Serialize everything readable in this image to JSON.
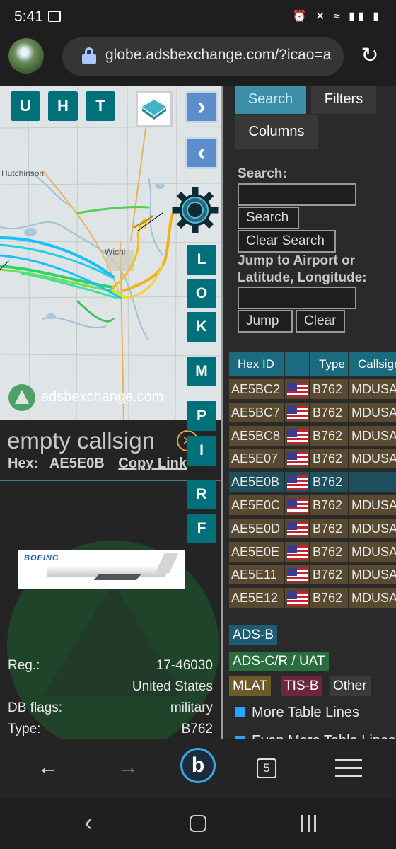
{
  "status_bar": {
    "time": "5:41",
    "icons_text": "⏰ ✕ ≈ ▮▮ ▮"
  },
  "browser": {
    "url": "globe.adsbexchange.com/?icao=a",
    "tab_count": "5"
  },
  "map": {
    "buttons": {
      "u": "U",
      "h": "H",
      "t": "T"
    },
    "place_labels": [
      "Hutchinson",
      "Wichi"
    ],
    "watermark": "adsbexchange.com",
    "side_buttons": [
      "L",
      "O",
      "K",
      "M",
      "P",
      "I",
      "R",
      "F"
    ]
  },
  "aircraft": {
    "callsign": "empty callsign",
    "hex_label": "Hex:",
    "hex_value": "AE5E0B",
    "copy_link": "Copy Link",
    "photo_brand": "BOEING",
    "details": [
      {
        "key": "Reg.:",
        "value": "17-46030"
      },
      {
        "key": "",
        "value": "United States"
      },
      {
        "key": "DB flags:",
        "value": "military"
      },
      {
        "key": "Type:",
        "value": "B762"
      }
    ]
  },
  "panel": {
    "tabs": {
      "search": "Search",
      "filters": "Filters",
      "columns": "Columns"
    },
    "search_label": "Search:",
    "search_button": "Search",
    "clear_search_button": "Clear Search",
    "jump_label": "Jump to Airport or Latitude, Longitude:",
    "jump_button": "Jump",
    "clear_button": "Clear",
    "table": {
      "headers": [
        "Hex ID",
        "",
        "Type",
        "Callsign"
      ],
      "rows": [
        {
          "hex": "AE5BC2",
          "type": "B762",
          "callsign": "MDUSA",
          "selected": false
        },
        {
          "hex": "AE5BC7",
          "type": "B762",
          "callsign": "MDUSA",
          "selected": false
        },
        {
          "hex": "AE5BC8",
          "type": "B762",
          "callsign": "MDUSA",
          "selected": false
        },
        {
          "hex": "AE5E07",
          "type": "B762",
          "callsign": "MDUSA",
          "selected": false
        },
        {
          "hex": "AE5E0B",
          "type": "B762",
          "callsign": "",
          "selected": true
        },
        {
          "hex": "AE5E0C",
          "type": "B762",
          "callsign": "MDUSA",
          "selected": false
        },
        {
          "hex": "AE5E0D",
          "type": "B762",
          "callsign": "MDUSA",
          "selected": false
        },
        {
          "hex": "AE5E0E",
          "type": "B762",
          "callsign": "MDUSA",
          "selected": false
        },
        {
          "hex": "AE5E11",
          "type": "B762",
          "callsign": "MDUSA",
          "selected": false
        },
        {
          "hex": "AE5E12",
          "type": "B762",
          "callsign": "MDUSA",
          "selected": false
        }
      ]
    },
    "legend": {
      "adsb": "ADS-B",
      "adsc": "ADS-C/R / UAT",
      "mlat": "MLAT",
      "tisb": "TIS-B",
      "other": "Other"
    },
    "more_lines": "More Table Lines",
    "even_more_lines": "Even More Table Lines"
  },
  "colors": {
    "teal_button": "#00707a",
    "row_bg": "#584930",
    "row_selected_bg": "#1e4f5c",
    "adsb": "#1e5b74",
    "adsc": "#2a6e3e",
    "mlat": "#6b5a2a",
    "tisb": "#6e2640",
    "other": "#3a3a3a"
  }
}
